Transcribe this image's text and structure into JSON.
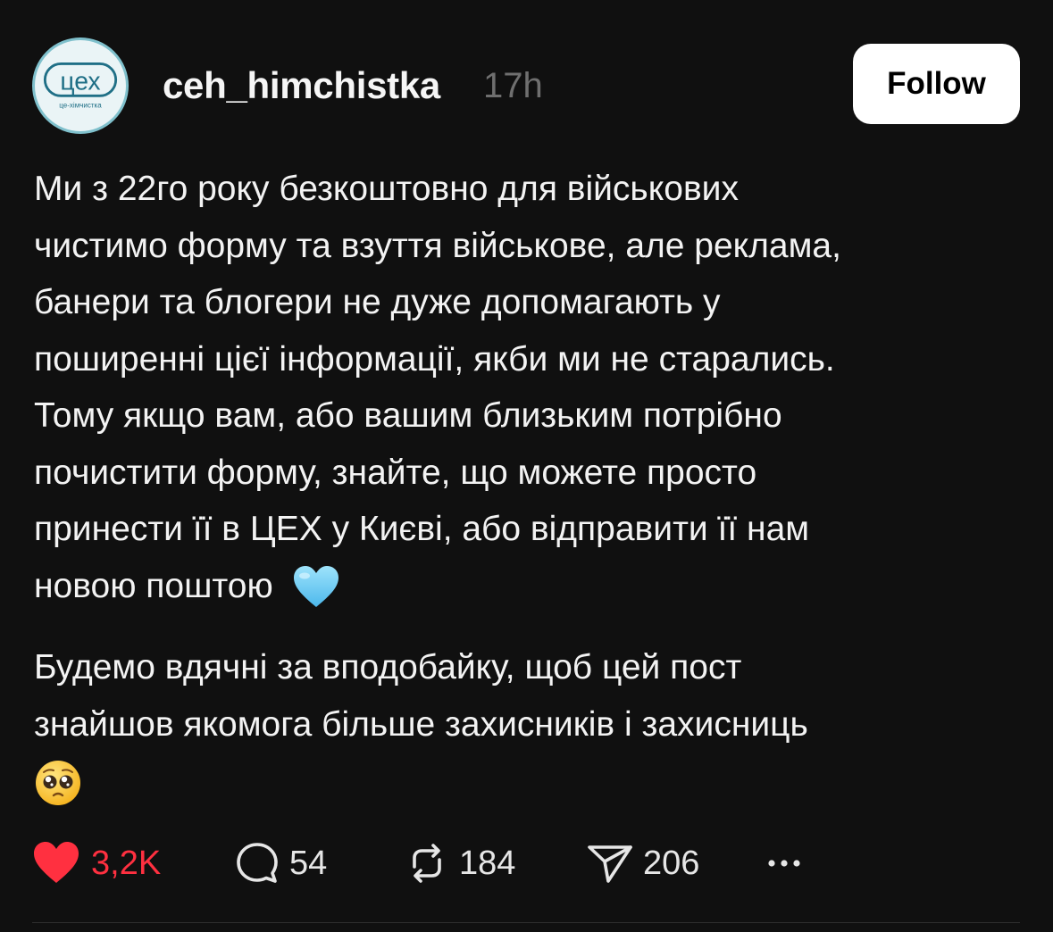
{
  "post": {
    "avatar": {
      "logo_text": "цех",
      "logo_subtext": "це-хімчистка",
      "accent_color": "#7fc0cc"
    },
    "username": "ceh_himchistka",
    "time_ago": "17h",
    "follow_label": "Follow",
    "paragraph1": {
      "lines": [
        "Ми з 22го року безкоштовно для військових",
        "чистимо форму та взуття військове, але реклама,",
        "банери та блогери не дуже допомагають у",
        "поширенні цієї інформації, якби ми не старались.",
        "Тому якщо вам, або вашим близьким потрібно",
        "почистити форму, знайте, що можете просто",
        "принести її в ЦЕХ у Києві, або відправити її нам",
        "новою поштою"
      ],
      "trailing_emoji": "light-blue-heart-emoji"
    },
    "paragraph2": {
      "lines": [
        "Будемо вдячні за вподобайку, щоб цей пост",
        "знайшов якомога більше захисників і захисниць"
      ],
      "trailing_emoji": "pleading-face-emoji"
    },
    "actions": {
      "likes": "3,2K",
      "replies": "54",
      "reposts": "184",
      "shares": "206",
      "like_color": "#ff3040",
      "liked": true
    }
  }
}
